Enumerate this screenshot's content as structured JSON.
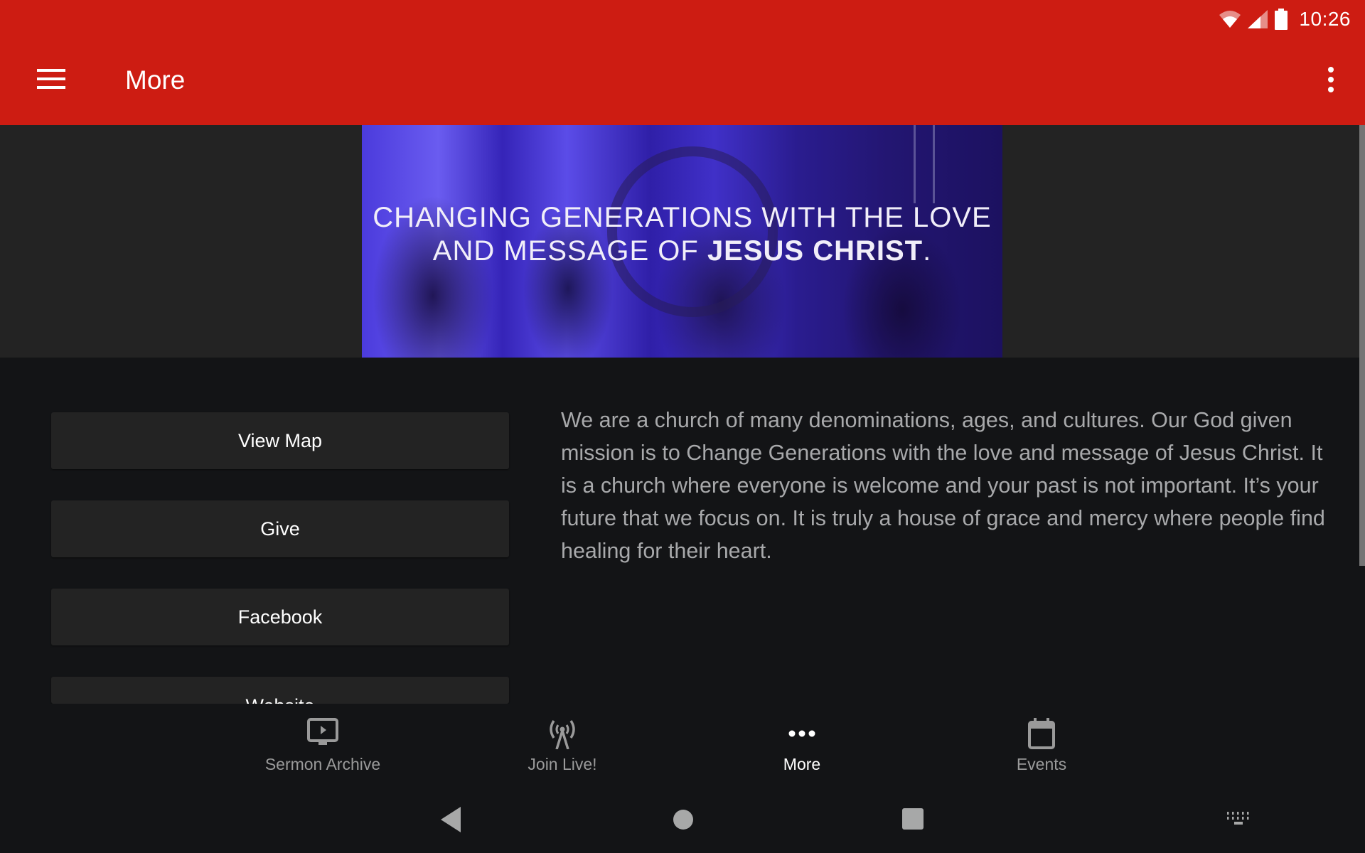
{
  "status_bar": {
    "time": "10:26",
    "icons": [
      "wifi-icon",
      "cell-signal-icon",
      "battery-icon"
    ]
  },
  "app_bar": {
    "menu_icon": "hamburger-menu-icon",
    "title": "More",
    "overflow_icon": "more-vert-icon"
  },
  "hero": {
    "line1": "CHANGING GENERATIONS WITH THE LOVE",
    "line2_prefix": "AND MESSAGE OF ",
    "line2_bold": "JESUS CHRIST",
    "line2_suffix": "."
  },
  "actions": [
    {
      "label": "View Map"
    },
    {
      "label": "Give"
    },
    {
      "label": "Facebook"
    },
    {
      "label": "Website"
    }
  ],
  "about_text": "We are a church of many denominations, ages, and cultures. Our God given mission is to Change Generations with the love and message of Jesus Christ. It is a church where everyone is welcome and your past is not important.  It’s your future that we focus on.  It is truly a house of grace and mercy where people find healing for their heart.",
  "bottom_nav": {
    "items": [
      {
        "label": "Sermon Archive",
        "icon": "video-play-icon",
        "active": false
      },
      {
        "label": "Join Live!",
        "icon": "broadcast-antenna-icon",
        "active": false
      },
      {
        "label": "More",
        "icon": "more-horiz-icon",
        "active": true
      },
      {
        "label": "Events",
        "icon": "calendar-icon",
        "active": false
      }
    ]
  },
  "system_nav": {
    "buttons": [
      "back-icon",
      "home-icon",
      "recents-icon",
      "keyboard-icon"
    ]
  },
  "colors": {
    "app_bar": "#cd1c12",
    "background": "#131416",
    "hero_band": "#232323",
    "button_bg": "#232323",
    "body_text": "#a8a9ab",
    "nav_inactive": "#9a9a9a",
    "nav_active": "#ffffff"
  }
}
